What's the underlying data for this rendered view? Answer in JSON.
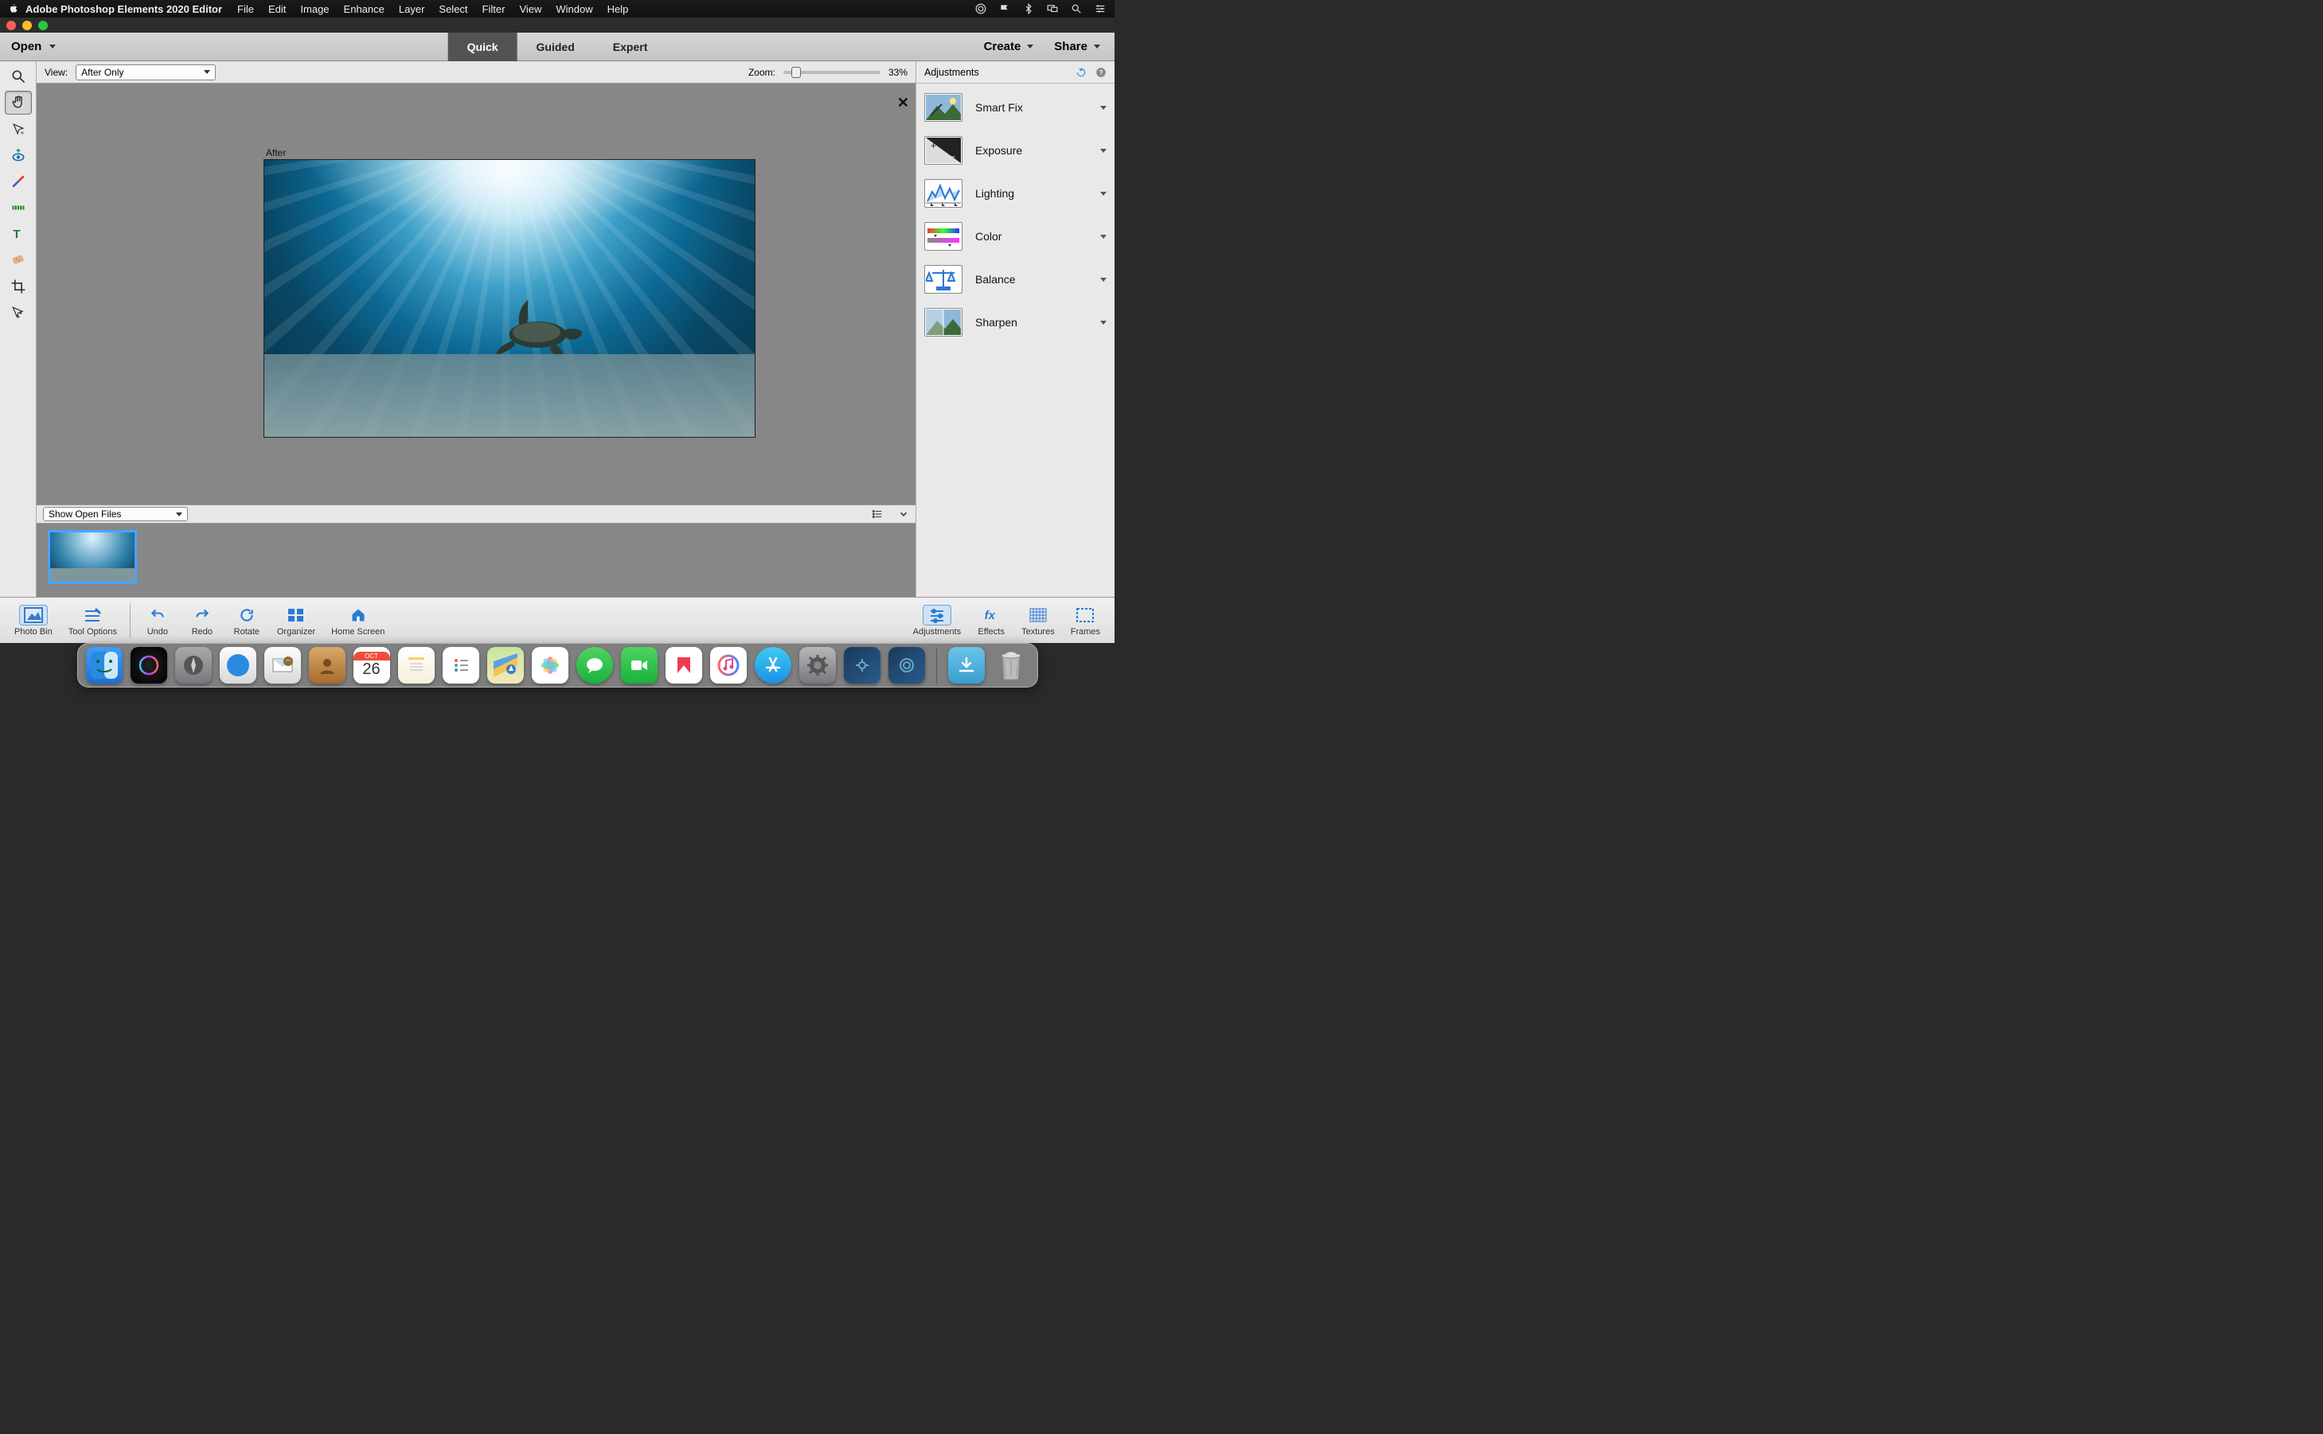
{
  "menubar": {
    "apple": "",
    "app_name": "Adobe Photoshop Elements 2020 Editor",
    "items": [
      "File",
      "Edit",
      "Image",
      "Enhance",
      "Layer",
      "Select",
      "Filter",
      "View",
      "Window",
      "Help"
    ]
  },
  "app_bar": {
    "open": "Open",
    "tabs": [
      "Quick",
      "Guided",
      "Expert"
    ],
    "active_tab": "Quick",
    "create": "Create",
    "share": "Share"
  },
  "options_bar": {
    "view_label": "View:",
    "view_value": "After Only",
    "zoom_label": "Zoom:",
    "zoom_value": "33%"
  },
  "canvas": {
    "after_label": "After"
  },
  "openfiles": {
    "label": "Show Open Files"
  },
  "adjustments": {
    "title": "Adjustments",
    "items": [
      {
        "label": "Smart Fix"
      },
      {
        "label": "Exposure"
      },
      {
        "label": "Lighting"
      },
      {
        "label": "Color"
      },
      {
        "label": "Balance"
      },
      {
        "label": "Sharpen"
      }
    ]
  },
  "shelf": {
    "left": [
      {
        "label": "Photo Bin"
      },
      {
        "label": "Tool Options"
      },
      {
        "label": "Undo"
      },
      {
        "label": "Redo"
      },
      {
        "label": "Rotate"
      },
      {
        "label": "Organizer"
      },
      {
        "label": "Home Screen"
      }
    ],
    "right": [
      {
        "label": "Adjustments"
      },
      {
        "label": "Effects"
      },
      {
        "label": "Textures"
      },
      {
        "label": "Frames"
      }
    ]
  },
  "dock": {
    "calendar_month": "OCT",
    "calendar_day": "26"
  }
}
